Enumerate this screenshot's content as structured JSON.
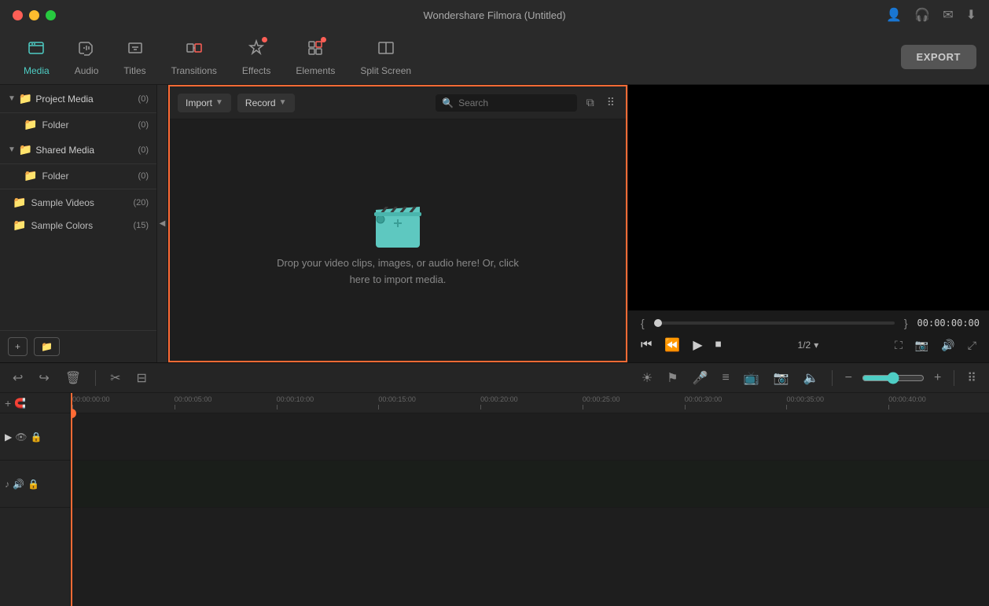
{
  "window": {
    "title": "Wondershare Filmora (Untitled)"
  },
  "toolbar": {
    "export_label": "EXPORT",
    "tabs": [
      {
        "id": "media",
        "label": "Media",
        "icon": "📁",
        "active": true,
        "badge": false
      },
      {
        "id": "audio",
        "label": "Audio",
        "icon": "♪",
        "active": false,
        "badge": false
      },
      {
        "id": "titles",
        "label": "Titles",
        "icon": "T",
        "active": false,
        "badge": false
      },
      {
        "id": "transitions",
        "label": "Transitions",
        "icon": "⧉",
        "active": false,
        "badge": false
      },
      {
        "id": "effects",
        "label": "Effects",
        "icon": "✦",
        "active": false,
        "badge": true
      },
      {
        "id": "elements",
        "label": "Elements",
        "icon": "⊞",
        "active": false,
        "badge": true
      },
      {
        "id": "split_screen",
        "label": "Split Screen",
        "icon": "▣",
        "active": false,
        "badge": false
      }
    ]
  },
  "left_panel": {
    "items": [
      {
        "id": "project_media",
        "label": "Project Media",
        "count": "(0)",
        "level": 0,
        "expanded": true
      },
      {
        "id": "folder_1",
        "label": "Folder",
        "count": "(0)",
        "level": 1
      },
      {
        "id": "shared_media",
        "label": "Shared Media",
        "count": "(0)",
        "level": 0,
        "expanded": true
      },
      {
        "id": "folder_2",
        "label": "Folder",
        "count": "(0)",
        "level": 1
      },
      {
        "id": "sample_videos",
        "label": "Sample Videos",
        "count": "(20)",
        "level": 0
      },
      {
        "id": "sample_colors",
        "label": "Sample Colors",
        "count": "(15)",
        "level": 0
      }
    ]
  },
  "media_panel": {
    "import_label": "Import",
    "record_label": "Record",
    "search_placeholder": "Search",
    "drop_text_line1": "Drop your video clips, images, or audio here! Or, click",
    "drop_text_line2": "here to import media."
  },
  "preview": {
    "time_display": "00:00:00:00",
    "speed": "1/2",
    "bracket_left": "{",
    "bracket_right": "}"
  },
  "timeline": {
    "ruler_marks": [
      "00:00:00:00",
      "00:00:05:00",
      "00:00:10:00",
      "00:00:15:00",
      "00:00:20:00",
      "00:00:25:00",
      "00:00:30:00",
      "00:00:35:00",
      "00:00:40:00"
    ]
  }
}
